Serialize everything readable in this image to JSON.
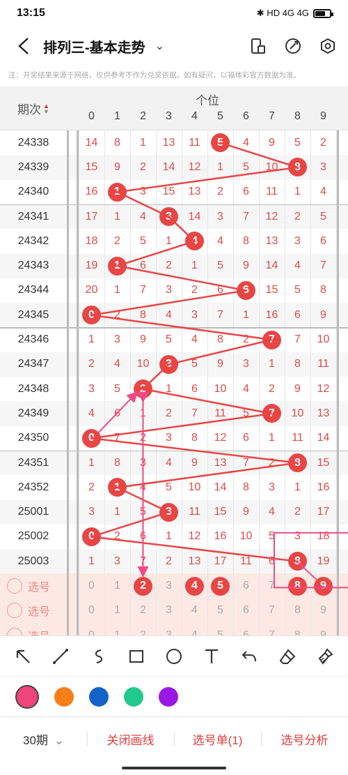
{
  "status_bar": {
    "time": "13:15",
    "icons_text": "✱ HD 4G 4G"
  },
  "header": {
    "title": "排列三-基本走势",
    "chevron": "⌄"
  },
  "notice": "注：开奖结果来源于网络，仅供参考不作为兑奖依据。如有疑问，以福体彩官方数据为准。",
  "table": {
    "period_header": "期次",
    "group_title": "个位",
    "digit_headers": [
      "0",
      "1",
      "2",
      "3",
      "4",
      "5",
      "6",
      "7",
      "8",
      "9"
    ],
    "rows": [
      {
        "period": "24338",
        "cells": [
          "14",
          "8",
          "1",
          "13",
          "11",
          "5",
          "4",
          "9",
          "5",
          "2"
        ],
        "hit": 5
      },
      {
        "period": "24339",
        "cells": [
          "15",
          "9",
          "2",
          "14",
          "12",
          "1",
          "5",
          "10",
          "8",
          "3"
        ],
        "hit": 8
      },
      {
        "period": "24340",
        "cells": [
          "16",
          "1",
          "3",
          "15",
          "13",
          "2",
          "6",
          "11",
          "1",
          "4"
        ],
        "hit": 1
      },
      {
        "period": "24341",
        "cells": [
          "17",
          "1",
          "4",
          "3",
          "14",
          "3",
          "7",
          "12",
          "2",
          "5"
        ],
        "hit": 3
      },
      {
        "period": "24342",
        "cells": [
          "18",
          "2",
          "5",
          "1",
          "4",
          "4",
          "8",
          "13",
          "3",
          "6"
        ],
        "hit": 4
      },
      {
        "period": "24343",
        "cells": [
          "19",
          "1",
          "6",
          "2",
          "1",
          "5",
          "9",
          "14",
          "4",
          "7"
        ],
        "hit": 1
      },
      {
        "period": "24344",
        "cells": [
          "20",
          "1",
          "7",
          "3",
          "2",
          "6",
          "6",
          "15",
          "5",
          "8"
        ],
        "hit": 6
      },
      {
        "period": "24345",
        "cells": [
          "0",
          "2",
          "8",
          "4",
          "3",
          "7",
          "1",
          "16",
          "6",
          "9"
        ],
        "hit": 0
      },
      {
        "period": "24346",
        "cells": [
          "1",
          "3",
          "9",
          "5",
          "4",
          "8",
          "2",
          "7",
          "7",
          "10"
        ],
        "hit": 7
      },
      {
        "period": "24347",
        "cells": [
          "2",
          "4",
          "10",
          "3",
          "5",
          "9",
          "3",
          "1",
          "8",
          "11"
        ],
        "hit": 3
      },
      {
        "period": "24348",
        "cells": [
          "3",
          "5",
          "2",
          "1",
          "6",
          "10",
          "4",
          "2",
          "9",
          "12"
        ],
        "hit": 2
      },
      {
        "period": "24349",
        "cells": [
          "4",
          "6",
          "1",
          "2",
          "7",
          "11",
          "5",
          "7",
          "10",
          "13"
        ],
        "hit": 7
      },
      {
        "period": "24350",
        "cells": [
          "0",
          "7",
          "2",
          "3",
          "8",
          "12",
          "6",
          "1",
          "11",
          "14"
        ],
        "hit": 0
      },
      {
        "period": "24351",
        "cells": [
          "1",
          "8",
          "3",
          "4",
          "9",
          "13",
          "7",
          "2",
          "8",
          "15"
        ],
        "hit": 8
      },
      {
        "period": "24352",
        "cells": [
          "2",
          "1",
          "4",
          "5",
          "10",
          "14",
          "8",
          "3",
          "1",
          "16"
        ],
        "hit": 1
      },
      {
        "period": "25001",
        "cells": [
          "3",
          "1",
          "5",
          "3",
          "11",
          "15",
          "9",
          "4",
          "2",
          "17"
        ],
        "hit": 3
      },
      {
        "period": "25002",
        "cells": [
          "0",
          "2",
          "6",
          "1",
          "12",
          "16",
          "10",
          "5",
          "3",
          "18"
        ],
        "hit": 0
      },
      {
        "period": "25003",
        "cells": [
          "1",
          "3",
          "7",
          "2",
          "13",
          "17",
          "11",
          "6",
          "8",
          "19"
        ],
        "hit": 8
      }
    ],
    "select_rows": [
      {
        "label": "选号",
        "cells": [
          "0",
          "1",
          "2",
          "3",
          "4",
          "5",
          "6",
          "7",
          "8",
          "9"
        ],
        "picked": [
          2,
          4,
          5,
          8,
          9
        ]
      },
      {
        "label": "选号",
        "cells": [
          "0",
          "1",
          "2",
          "3",
          "4",
          "5",
          "6",
          "7",
          "8",
          "9"
        ],
        "picked": []
      },
      {
        "label": "选号",
        "cells": [
          "0",
          "1",
          "2",
          "3",
          "4",
          "5",
          "6",
          "7",
          "8",
          "9"
        ],
        "picked": []
      }
    ]
  },
  "palette": [
    "#f0457a",
    "#f77f16",
    "#1463c8",
    "#21c98e",
    "#9a18e6"
  ],
  "bottom": {
    "period": "30期",
    "period_chevron": "⌄",
    "close_draw": "关闭画线",
    "selection": "选号单(1)",
    "analysis": "选号分析"
  }
}
